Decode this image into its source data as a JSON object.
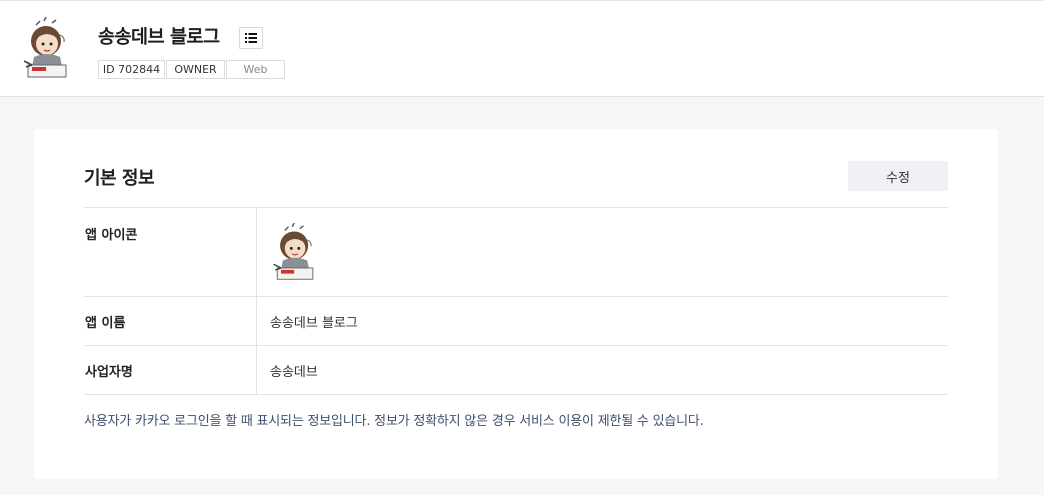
{
  "header": {
    "app_name": "송송데브 블로그",
    "list_icon": "list-icon",
    "badges": {
      "id": "ID 702844",
      "role": "OWNER",
      "platform": "Web"
    }
  },
  "basic_info": {
    "title": "기본 정보",
    "edit_label": "수정",
    "rows": {
      "app_icon": {
        "label": "앱 아이콘"
      },
      "app_name": {
        "label": "앱 이름",
        "value": "송송데브 블로그"
      },
      "business_name": {
        "label": "사업자명",
        "value": "송송데브"
      }
    },
    "note": "사용자가 카카오 로그인을 할 때 표시되는 정보입니다. 정보가 정확하지 않은 경우 서비스 이용이 제한될 수 있습니다."
  }
}
